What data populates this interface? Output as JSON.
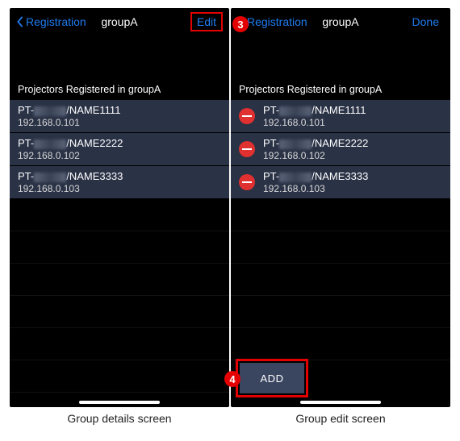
{
  "common": {
    "back_label": "Registration",
    "title": "groupA",
    "section_header": "Projectors Registered in groupA",
    "projectors": [
      {
        "model_prefix": "PT-",
        "name_suffix": "/NAME1111",
        "ip": "192.168.0.101"
      },
      {
        "model_prefix": "PT-",
        "name_suffix": "/NAME2222",
        "ip": "192.168.0.102"
      },
      {
        "model_prefix": "PT-",
        "name_suffix": "/NAME3333",
        "ip": "192.168.0.103"
      }
    ]
  },
  "left": {
    "action_label": "Edit",
    "caption": "Group details screen"
  },
  "right": {
    "action_label": "Done",
    "add_label": "ADD",
    "caption": "Group edit screen"
  },
  "callouts": {
    "edit": "3",
    "add": "4"
  }
}
